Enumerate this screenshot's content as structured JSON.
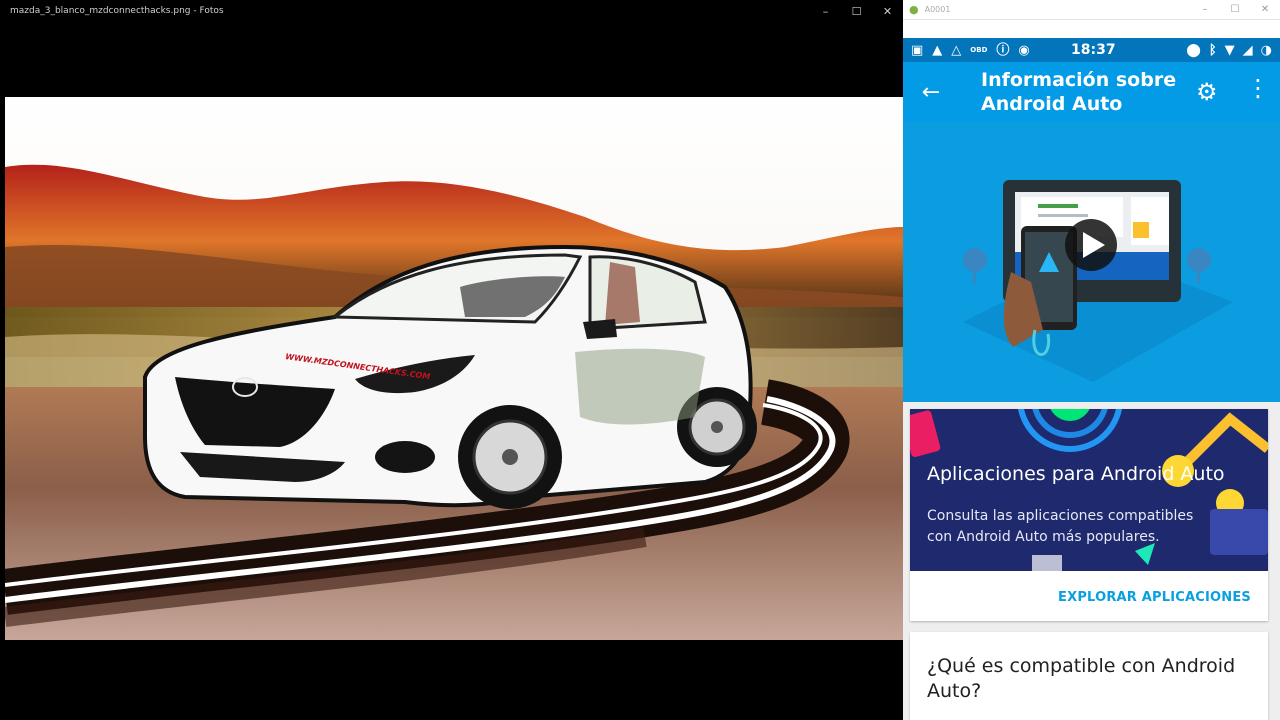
{
  "photos_window": {
    "title": "mazda_3_blanco_mzdconnecthacks.png - Fotos",
    "controls": {
      "minimize": "–",
      "maximize": "☐",
      "close": "✕"
    },
    "watermark": "WWW.MZDCONNECTHACKS.COM"
  },
  "emulator_window": {
    "title": "A0001",
    "controls": {
      "minimize": "–",
      "maximize": "☐",
      "close": "✕"
    }
  },
  "status_bar": {
    "time": "18:37",
    "obd": "OBD",
    "left_icons": [
      "chat-icon",
      "navigation-icon",
      "navigation-outline-icon",
      "obd-icon",
      "info-icon",
      "android-auto-icon"
    ],
    "right_icons": [
      "location-icon",
      "bluetooth-icon",
      "wifi-icon",
      "signal-icon",
      "battery-icon"
    ]
  },
  "app_bar": {
    "title": "Información sobre Android Auto",
    "back_icon": "arrow-back-icon",
    "settings_icon": "gear-icon",
    "more_icon": "more-vert-icon"
  },
  "apps_card": {
    "title": "Aplicaciones para Android Auto",
    "body": "Consulta las aplicaciones compatibles con Android Auto más populares.",
    "action": "EXPLORAR APLICACIONES"
  },
  "compat_card": {
    "title": "¿Qué es compatible con Android Auto?"
  },
  "colors": {
    "status_bar": "#0275bb",
    "app_bar": "#039be5",
    "hero": "#0b9de0",
    "accent": "#0aa0e0",
    "banner": "#1f2a6e"
  }
}
